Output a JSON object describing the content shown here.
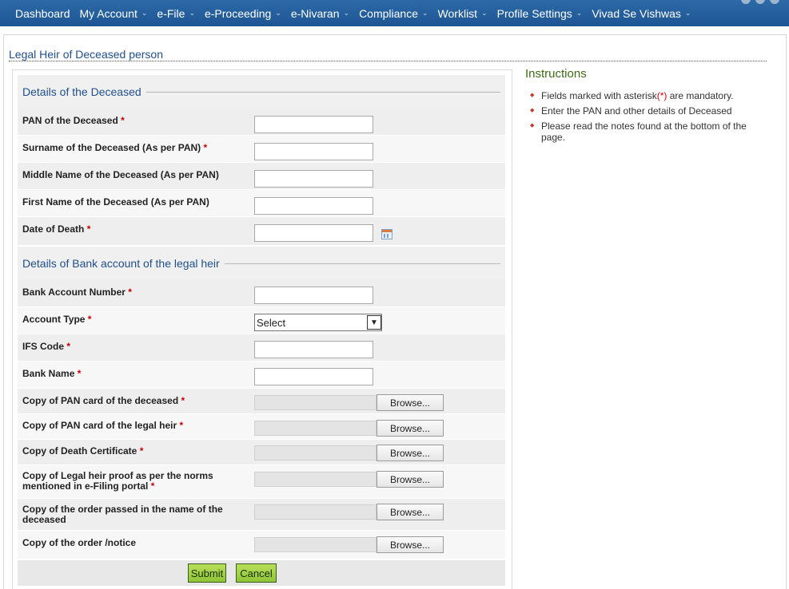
{
  "nav": {
    "items": [
      {
        "label": "Dashboard",
        "dropdown": false
      },
      {
        "label": "My Account",
        "dropdown": true
      },
      {
        "label": "e-File",
        "dropdown": true
      },
      {
        "label": "e-Proceeding",
        "dropdown": true
      },
      {
        "label": "e-Nivaran",
        "dropdown": true
      },
      {
        "label": "Compliance",
        "dropdown": true
      },
      {
        "label": "Worklist",
        "dropdown": true
      },
      {
        "label": "Profile Settings",
        "dropdown": true
      },
      {
        "label": "Vivad Se Vishwas",
        "dropdown": true
      }
    ]
  },
  "page": {
    "title": "Legal Heir of Deceased person"
  },
  "sections": {
    "deceased": "Details of the Deceased",
    "bank": "Details of Bank account of the legal heir"
  },
  "fields": {
    "pan": {
      "label": "PAN of the Deceased",
      "value": ""
    },
    "surname": {
      "label": "Surname of the Deceased (As per PAN)",
      "value": ""
    },
    "middle": {
      "label": "Middle Name of the Deceased (As per PAN)",
      "value": ""
    },
    "first": {
      "label": "First Name of the Deceased (As per PAN)",
      "value": ""
    },
    "dod": {
      "label": "Date of Death",
      "value": ""
    },
    "account_number": {
      "label": "Bank Account Number",
      "value": ""
    },
    "account_type": {
      "label": "Account Type",
      "selected": "Select"
    },
    "ifsc": {
      "label": "IFS Code",
      "value": ""
    },
    "bank_name": {
      "label": "Bank Name",
      "value": ""
    },
    "pan_card_deceased": {
      "label": "Copy of PAN card of the deceased"
    },
    "pan_card_heir": {
      "label": "Copy of PAN card of the legal heir"
    },
    "death_cert": {
      "label": "Copy of Death Certificate"
    },
    "heir_proof": {
      "label": "Copy of Legal heir proof as per the norms mentioned in e-Filing portal"
    },
    "order_deceased": {
      "label": "Copy of the order passed in the name of the deceased"
    },
    "order_notice": {
      "label": "Copy of the order /notice"
    }
  },
  "required_mark": "*",
  "browse_label": "Browse...",
  "buttons": {
    "submit": "Submit",
    "cancel": "Cancel"
  },
  "instructions": {
    "title": "Instructions",
    "items": [
      {
        "before": "Fields marked with asterisk",
        "mark": "(*)",
        "after": " are mandatory."
      },
      {
        "text": "Enter the PAN and other details of Deceased"
      },
      {
        "text": "Please read the notes found at the bottom of the page."
      }
    ]
  }
}
